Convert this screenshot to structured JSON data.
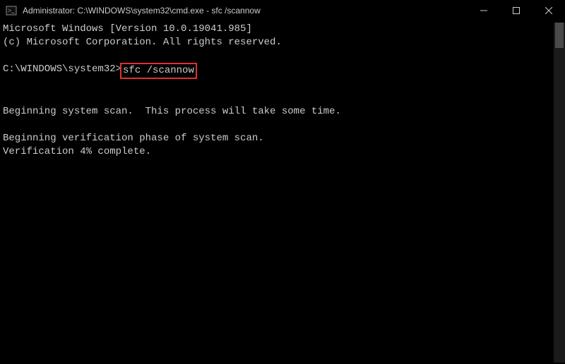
{
  "titlebar": {
    "title": "Administrator: C:\\WINDOWS\\system32\\cmd.exe - sfc  /scannow"
  },
  "console": {
    "version_line": "Microsoft Windows [Version 10.0.19041.985]",
    "copyright_line": "(c) Microsoft Corporation. All rights reserved.",
    "prompt": "C:\\WINDOWS\\system32>",
    "command": "sfc /scannow",
    "scan_start_line": "Beginning system scan.  This process will take some time.",
    "verify_line": "Beginning verification phase of system scan.",
    "progress_line": "Verification 4% complete."
  }
}
